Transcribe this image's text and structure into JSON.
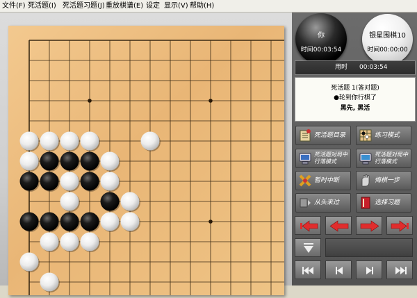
{
  "menu": [
    "文件(F)",
    "死活题(I)",
    "死活题习题(J)",
    "重放棋谱(E)",
    "设定",
    "显示(V)",
    "帮助(H)"
  ],
  "board": {
    "size": 19,
    "visible_columns": 13,
    "visible_rows": 13,
    "stones": [
      {
        "row": 5,
        "col": 0,
        "color": "white"
      },
      {
        "row": 5,
        "col": 1,
        "color": "white"
      },
      {
        "row": 5,
        "col": 2,
        "color": "white"
      },
      {
        "row": 5,
        "col": 3,
        "color": "white"
      },
      {
        "row": 5,
        "col": 6,
        "color": "white"
      },
      {
        "row": 6,
        "col": 0,
        "color": "white"
      },
      {
        "row": 6,
        "col": 1,
        "color": "black"
      },
      {
        "row": 6,
        "col": 2,
        "color": "black"
      },
      {
        "row": 6,
        "col": 3,
        "color": "black"
      },
      {
        "row": 6,
        "col": 4,
        "color": "white"
      },
      {
        "row": 7,
        "col": 0,
        "color": "black"
      },
      {
        "row": 7,
        "col": 1,
        "color": "black"
      },
      {
        "row": 7,
        "col": 2,
        "color": "white"
      },
      {
        "row": 7,
        "col": 3,
        "color": "black"
      },
      {
        "row": 7,
        "col": 4,
        "color": "white"
      },
      {
        "row": 8,
        "col": 2,
        "color": "white"
      },
      {
        "row": 8,
        "col": 4,
        "color": "black"
      },
      {
        "row": 8,
        "col": 5,
        "color": "white"
      },
      {
        "row": 9,
        "col": 0,
        "color": "black"
      },
      {
        "row": 9,
        "col": 1,
        "color": "black"
      },
      {
        "row": 9,
        "col": 2,
        "color": "black"
      },
      {
        "row": 9,
        "col": 3,
        "color": "black"
      },
      {
        "row": 9,
        "col": 4,
        "color": "white"
      },
      {
        "row": 9,
        "col": 5,
        "color": "white"
      },
      {
        "row": 10,
        "col": 1,
        "color": "white"
      },
      {
        "row": 10,
        "col": 2,
        "color": "white"
      },
      {
        "row": 10,
        "col": 3,
        "color": "white"
      },
      {
        "row": 11,
        "col": 0,
        "color": "white"
      },
      {
        "row": 12,
        "col": 1,
        "color": "white"
      }
    ]
  },
  "players": {
    "black": {
      "name": "你",
      "time": "时间00:03:54"
    },
    "white": {
      "name": "银星围棋10",
      "time": "时间00:00:00"
    }
  },
  "elapsed": {
    "label": "用时",
    "value": "00:03:54"
  },
  "problem": {
    "title": "死活题 1(答对题)",
    "status": "●轮到你行棋了",
    "task": "黑先, 黑活"
  },
  "tools": [
    {
      "label": "死活题目录",
      "icon": "book-icon"
    },
    {
      "label": "练习模式",
      "icon": "grid-icon"
    },
    {
      "label": "死活题对局中行落模式",
      "icon": "computer-icon"
    },
    {
      "label": "死活题对局中行落模式",
      "icon": "computer-icon"
    },
    {
      "label": "暂时中断",
      "icon": "pause-icon"
    },
    {
      "label": "悔棋一步",
      "icon": "hand-icon"
    },
    {
      "label": "从头来过",
      "icon": "restart-icon"
    },
    {
      "label": "选择习题",
      "icon": "book-red-icon"
    }
  ],
  "colors": {
    "arrow_red": "#e02d2d",
    "board": "#ecbd7f",
    "panel": "#5e5e5e"
  }
}
